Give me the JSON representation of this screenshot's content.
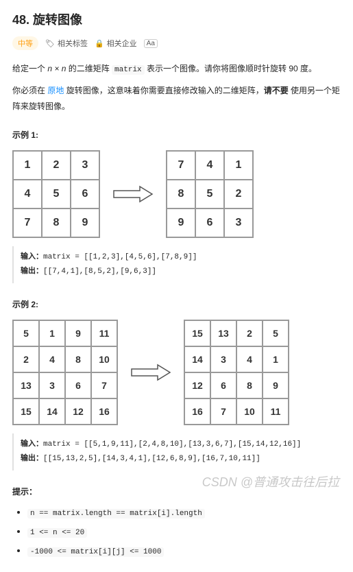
{
  "title": "48. 旋转图像",
  "difficulty": "中等",
  "tags": {
    "topics": "相关标签",
    "companies": "相关企业"
  },
  "description": {
    "p1a": "给定一个 ",
    "p1_var": "n × n",
    "p1b": " 的二维矩阵 ",
    "p1_code": "matrix",
    "p1c": " 表示一个图像。请你将图像顺时针旋转 90 度。",
    "p2a": "你必须在 ",
    "p2_highlight": "原地",
    "p2b": " 旋转图像，这意味着你需要直接修改输入的二维矩阵，",
    "p2_bold": "请不要",
    "p2c": " 使用另一个矩阵来旋转图像。"
  },
  "example1": {
    "label": "示例 1:",
    "before": [
      [
        1,
        2,
        3
      ],
      [
        4,
        5,
        6
      ],
      [
        7,
        8,
        9
      ]
    ],
    "after": [
      [
        7,
        4,
        1
      ],
      [
        8,
        5,
        2
      ],
      [
        9,
        6,
        3
      ]
    ],
    "input_label": "输入：",
    "input_code": "matrix = [[1,2,3],[4,5,6],[7,8,9]]",
    "output_label": "输出：",
    "output_code": "[[7,4,1],[8,5,2],[9,6,3]]"
  },
  "example2": {
    "label": "示例 2:",
    "before": [
      [
        5,
        1,
        9,
        11
      ],
      [
        2,
        4,
        8,
        10
      ],
      [
        13,
        3,
        6,
        7
      ],
      [
        15,
        14,
        12,
        16
      ]
    ],
    "after": [
      [
        15,
        13,
        2,
        5
      ],
      [
        14,
        3,
        4,
        1
      ],
      [
        12,
        6,
        8,
        9
      ],
      [
        16,
        7,
        10,
        11
      ]
    ],
    "input_label": "输入：",
    "input_code": "matrix = [[5,1,9,11],[2,4,8,10],[13,3,6,7],[15,14,12,16]]",
    "output_label": "输出：",
    "output_code": "[[15,13,2,5],[14,3,4,1],[12,6,8,9],[16,7,10,11]]"
  },
  "constraints": {
    "label": "提示：",
    "items": [
      "n == matrix.length == matrix[i].length",
      "1 <= n <= 20",
      "-1000 <= matrix[i][j] <= 1000"
    ]
  },
  "watermark": "CSDN @普通攻击往后拉"
}
